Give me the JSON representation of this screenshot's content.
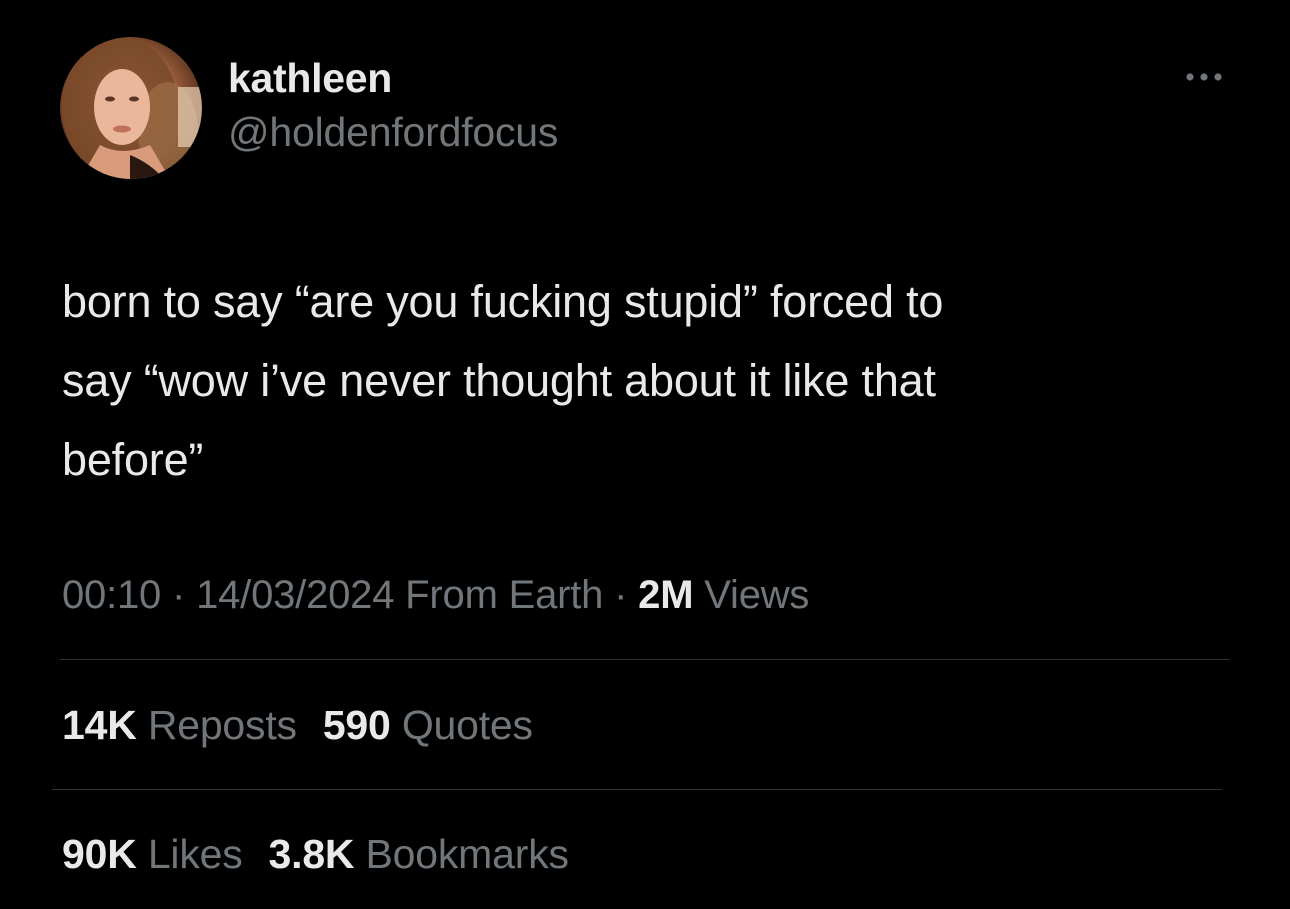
{
  "author": {
    "display_name": "kathleen",
    "handle": "@holdenfordfocus",
    "avatar_icon": "profile-photo"
  },
  "tweet": {
    "text": "born to say “are you fucking stupid” forced to\nsay “wow i’ve never thought about it like that\nbefore”"
  },
  "meta": {
    "time": "00:10",
    "separator1": " · ",
    "date": "14/03/2024",
    "source": " From Earth",
    "separator2": " · ",
    "views_count": "2M",
    "views_label": " Views"
  },
  "stats": {
    "reposts_count": "14K",
    "reposts_label": " Reposts",
    "quotes_count": "590",
    "quotes_label": " Quotes",
    "likes_count": "90K",
    "likes_label": " Likes",
    "bookmarks_count": "3.8K",
    "bookmarks_label": " Bookmarks"
  },
  "colors": {
    "background": "#000000",
    "primary_text": "#e7e9ea",
    "secondary_text": "#71767b",
    "divider": "#2f3336"
  },
  "icons": {
    "more": "more-horizontal-icon"
  }
}
